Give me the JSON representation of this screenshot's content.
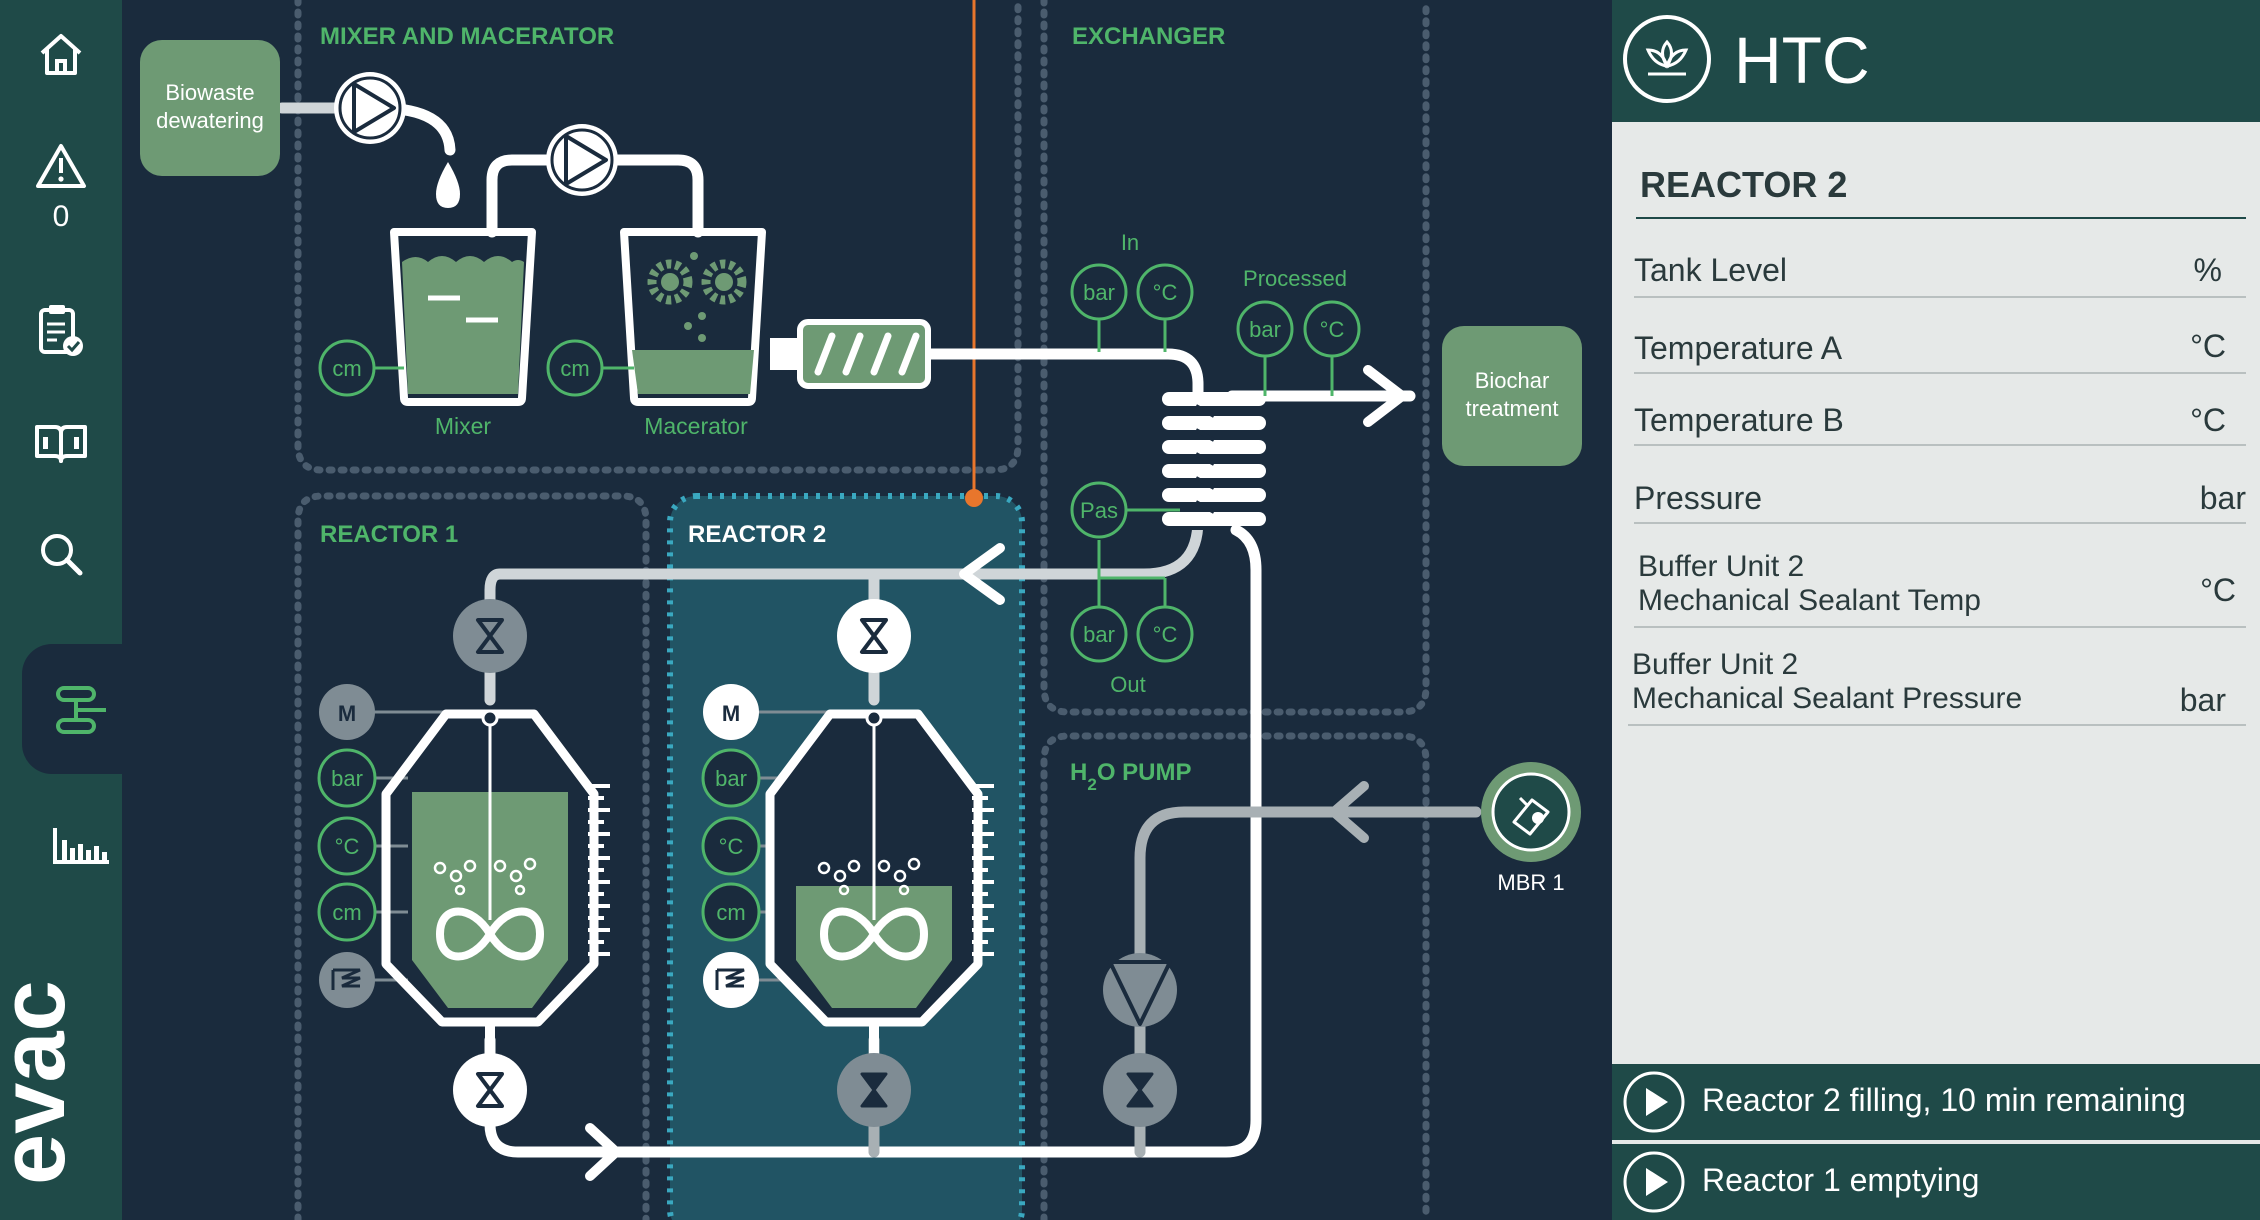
{
  "sidebar": {
    "alert_count": "0",
    "brand": "evac",
    "items": [
      {
        "icon": "home-icon"
      },
      {
        "icon": "warning-icon"
      },
      {
        "icon": "clipboard-check-icon"
      },
      {
        "icon": "manual-book-icon"
      },
      {
        "icon": "search-icon"
      },
      {
        "icon": "process-flow-icon",
        "active": true
      },
      {
        "icon": "bar-chart-icon"
      }
    ]
  },
  "diagram": {
    "sections": {
      "mixer_macerator": "MIXER AND MACERATOR",
      "exchanger": "EXCHANGER",
      "reactor1": "REACTOR 1",
      "reactor2": "REACTOR 2",
      "h2o_pump_main": "H",
      "h2o_pump_sub": "2",
      "h2o_pump_rest": "O PUMP"
    },
    "boxes": {
      "biowaste_line1": "Biowaste",
      "biowaste_line2": "dewatering",
      "biochar_line1": "Biochar",
      "biochar_line2": "treatment"
    },
    "labels": {
      "mixer": "Mixer",
      "macerator": "Macerator",
      "in": "In",
      "processed": "Processed",
      "out": "Out",
      "mbr1": "MBR 1"
    },
    "sensors": {
      "cm": "cm",
      "bar": "bar",
      "degc": "°C",
      "pas": "Pas",
      "motor": "M"
    }
  },
  "colors": {
    "background": "#1a2b3d",
    "accent_green": "#4fb56a",
    "tank_green": "#6e9a74",
    "pipe": "#ffffff",
    "orange_line": "#e8762c",
    "reactor2_highlight": "#215464",
    "panel_bg": "#e6e9e8",
    "panel_header": "#1f4a48"
  },
  "panel": {
    "title": "HTC",
    "section": "REACTOR 2",
    "rows": [
      {
        "line1": "Tank Level",
        "line2": "",
        "unit": "%"
      },
      {
        "line1": "Temperature  A",
        "line2": "",
        "unit": "°C"
      },
      {
        "line1": "Temperature  B",
        "line2": "",
        "unit": "°C"
      },
      {
        "line1": "Pressure",
        "line2": "",
        "unit": "bar"
      },
      {
        "line1": "Buffer Unit 2",
        "line2": "Mechanical Sealant Temp",
        "unit": "°C"
      },
      {
        "line1": "Buffer Unit 2",
        "line2": "Mechanical Sealant Pressure",
        "unit": "bar"
      }
    ],
    "status": [
      {
        "text": "Reactor 2 filling, 10 min remaining"
      },
      {
        "text": "Reactor 1 emptying"
      }
    ]
  }
}
